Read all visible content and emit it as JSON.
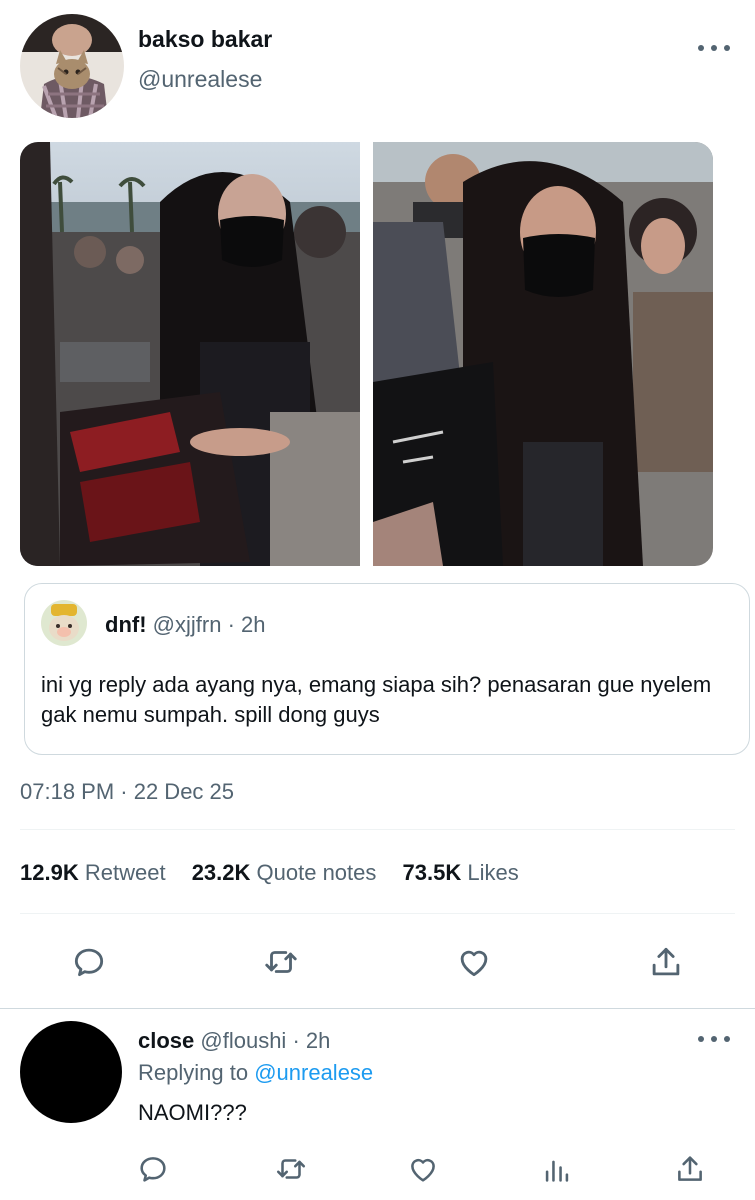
{
  "tweet": {
    "author_name": "bakso bakar",
    "author_handle": "@unrealese",
    "quote": {
      "name": "dnf!",
      "handle": "@xjjfrn",
      "time": "· 2h",
      "text": "ini yg reply ada ayang nya, emang siapa sih? penasaran gue nyelem gak nemu sumpah. spill dong guys"
    },
    "timestamp": "07:18 PM · 22 Dec 25",
    "stats": {
      "retweets": "12.9K",
      "retweets_label": "Retweet",
      "quotes": "23.2K",
      "quotes_label": "Quote notes",
      "likes": "73.5K",
      "likes_label": "Likes"
    },
    "icons": [
      "reply-icon",
      "retweet-icon",
      "like-icon",
      "share-icon",
      "more-icon"
    ]
  },
  "reply": {
    "name": "close",
    "handle": "@floushi",
    "time": "· 2h",
    "replying_prefix": "Replying to",
    "replying_handle": "@unrealese",
    "text": "NAOMI???",
    "icons": [
      "reply-icon",
      "retweet-icon",
      "like-icon",
      "views-icon",
      "share-icon"
    ]
  },
  "colors": {
    "text": "#0f1419",
    "secondary": "#536471",
    "link": "#1d9bf0",
    "border": "#cfd9de"
  }
}
